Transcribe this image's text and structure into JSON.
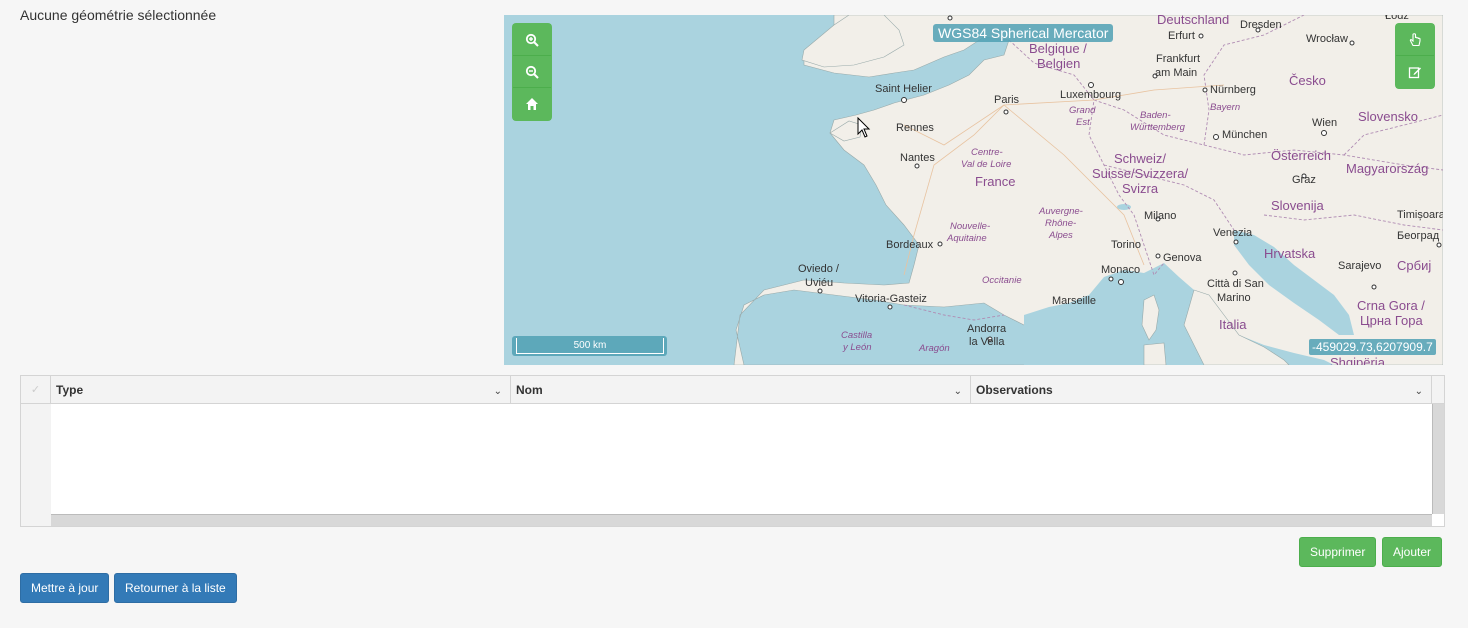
{
  "status": "Aucune géométrie sélectionnée",
  "map": {
    "projection": "WGS84 Spherical Mercator",
    "scale_label": "500 km",
    "coordinates": "-459029.73,6207909.7",
    "controls": {
      "zoom_in": "zoom-in-icon",
      "zoom_out": "zoom-out-icon",
      "home": "home-icon",
      "pan": "hand-pointer-icon",
      "edit": "edit-icon"
    },
    "labels": {
      "deutschland": "Deutschland",
      "belgique": "Belgique /",
      "belgien": "Belgien",
      "luxembourg": "Luxembourg",
      "grand_est_1": "Grand",
      "grand_est_2": "Est",
      "erfurt": "Erfurt",
      "dresden": "Dresden",
      "wroclaw": "Wrocław",
      "lodz": "Łódź",
      "frankfurt_1": "Frankfurt",
      "frankfurt_2": "am Main",
      "nurnberg": "Nürnberg",
      "bayern": "Bayern",
      "baden_1": "Baden-",
      "baden_2": "Württemberg",
      "munchen": "München",
      "cesko": "Česko",
      "wien": "Wien",
      "slovensko": "Slovensko",
      "osterreich": "Österreich",
      "magyarorszag": "Magyarország",
      "graz": "Graz",
      "slovenija": "Slovenija",
      "timisoara": "Timișoara",
      "beograd": "Београд",
      "srbija": "Србиј",
      "hrvatska": "Hrvatska",
      "sarajevo": "Sarajevo",
      "crna_gora_1": "Crna Gora /",
      "crna_gora_2": "Црна Гора",
      "shqiperia": "Shqipëria",
      "italia": "Italia",
      "citta_1": "Città di San",
      "citta_2": "Marino",
      "venezia": "Venezia",
      "milano": "Milano",
      "torino": "Torino",
      "genova": "Genova",
      "monaco": "Monaco",
      "marseille": "Marseille",
      "schweiz_1": "Schweiz/",
      "schweiz_2": "Suisse/Svizzera/",
      "schweiz_3": "Svizra",
      "auvergne_1": "Auvergne-",
      "auvergne_2": "Rhône-",
      "auvergne_3": "Alpes",
      "occitanie": "Occitanie",
      "andorra_1": "Andorra",
      "andorra_2": "la Vella",
      "aragon": "Aragón",
      "castilla_1": "Castilla",
      "castilla_2": "y León",
      "vitoria": "Vitoria-Gasteiz",
      "oviedo_1": "Oviedo /",
      "oviedo_2": "Uviéu",
      "bordeaux": "Bordeaux",
      "nouvelle_1": "Nouvelle-",
      "nouvelle_2": "Aquitaine",
      "nantes": "Nantes",
      "rennes": "Rennes",
      "saint_helier": "Saint Helier",
      "paris": "Paris",
      "france": "France",
      "centre_1": "Centre-",
      "centre_2": "Val de Loire"
    }
  },
  "grid": {
    "columns": [
      "Type",
      "Nom",
      "Observations"
    ],
    "select_all_icon": "check-icon",
    "sort_icon": "chevron-down-icon"
  },
  "buttons": {
    "delete": "Supprimer",
    "add": "Ajouter",
    "update": "Mettre à jour",
    "back": "Retourner à la liste"
  }
}
